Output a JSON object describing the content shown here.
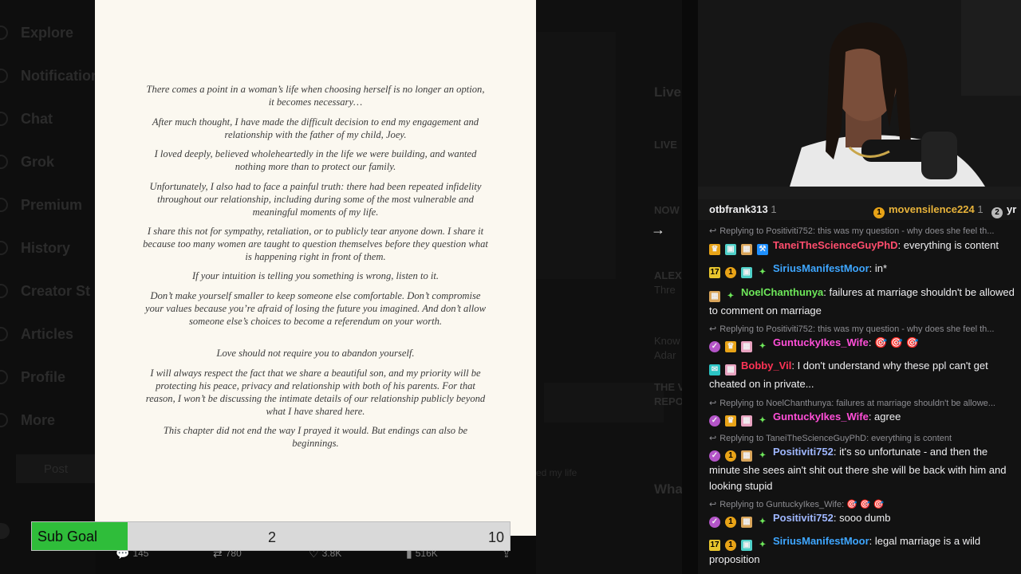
{
  "sidebar": {
    "items": [
      {
        "label": "Explore",
        "icon": "search-icon"
      },
      {
        "label": "Notifications",
        "icon": "bell-icon"
      },
      {
        "label": "Chat",
        "icon": "chat-icon"
      },
      {
        "label": "Grok",
        "icon": "grok-icon"
      },
      {
        "label": "Premium",
        "icon": "x-logo-icon"
      },
      {
        "label": "History",
        "icon": "history-icon"
      },
      {
        "label": "Creator St",
        "icon": "lightning-icon"
      },
      {
        "label": "Articles",
        "icon": "article-icon"
      },
      {
        "label": "Profile",
        "icon": "person-icon"
      },
      {
        "label": "More",
        "icon": "more-icon"
      }
    ],
    "post_button": "Post"
  },
  "document": {
    "paragraphs": [
      "There comes a point in a woman’s life when choosing herself is no longer an option, it becomes necessary…",
      "After much thought, I have made the difficult decision to end my engagement and relationship with the father of my child, Joey.",
      "I loved deeply, believed wholeheartedly in the life we were building, and wanted nothing more than to protect our family.",
      "Unfortunately, I also had to face a painful truth: there had been repeated infidelity throughout our relationship, including during some of the most vulnerable and meaningful moments of my life.",
      "I share this not for sympathy, retaliation, or to publicly tear anyone down. I share it because too many women are taught to question themselves before they question what is happening right in front of them.",
      "If your intuition is telling you something is wrong, listen to it.",
      "Don’t make yourself smaller to keep someone else comfortable. Don’t compromise your values because you’re afraid of losing the future you imagined. And don’t allow someone else’s choices to become a referendum on your worth.",
      "Love should not require you to abandon yourself.",
      "I will always respect the fact that we share a beautiful son, and my priority will be protecting his peace, privacy and relationship with both of his parents. For that reason, I won’t be discussing the intimate details of our relationship publicly beyond what I have shared here.",
      "This chapter did not end the way I prayed it would. But endings can also be beginnings."
    ]
  },
  "stats": {
    "replies": "145",
    "reposts": "780",
    "likes": "3.8K",
    "views": "516K"
  },
  "sub_goal": {
    "label": "Sub Goal",
    "current": "2",
    "target": "10",
    "fill_fraction": 0.2,
    "fill_color": "#2fbd3a"
  },
  "background_feed": {
    "right_fragments": [
      "Live",
      "LIVE",
      "NOW",
      "ALEX",
      "Thre",
      "Know",
      "Adar",
      "THE V",
      "REPO",
      "Wha"
    ],
    "caption_fragment": "ed my life"
  },
  "chat": {
    "pinned": [
      {
        "name": "otbfrank313",
        "count": "1"
      },
      {
        "name": "movensilence224",
        "count": "1",
        "badge": "1"
      },
      {
        "name": "yr",
        "badge": "2"
      }
    ],
    "messages": [
      {
        "reply": "Replying to Positiviti752: this was my question - why does she feel th...",
        "user": "TaneiTheScienceGuyPhD",
        "color": "#ff4d6d",
        "text": "everything is content",
        "badges": [
          "crown-icon",
          "cheer-icon",
          "gift-icon",
          "hammer-icon"
        ]
      },
      {
        "user": "SiriusManifestMoor",
        "color": "#3ea6ff",
        "text": "in*",
        "badges": [
          "17",
          "1",
          "cheer-icon",
          "plus-icon"
        ]
      },
      {
        "user": "NoelChanthunya",
        "color": "#6ee85a",
        "text": "failures at marriage shouldn't be allowed to comment on marriage",
        "badges": [
          "gift-icon",
          "plus-icon"
        ]
      },
      {
        "reply": "Replying to Positiviti752: this was my question - why does she feel th...",
        "user": "GuntuckyIkes_Wife",
        "color": "#ff4fd8",
        "text": "🎯 🎯 🎯",
        "badges": [
          "verified-icon",
          "crown-icon",
          "gift-icon",
          "plus-icon"
        ]
      },
      {
        "user": "Bobby_Vil",
        "color": "#ff3355",
        "text": "I don't understand why these ppl can't get cheated on in private...",
        "badges": [
          "prime-icon",
          "gift-icon"
        ]
      },
      {
        "reply": "Replying to NoelChanthunya: failures at marriage shouldn't be allowe...",
        "user": "GuntuckyIkes_Wife",
        "color": "#ff4fd8",
        "text": "agree",
        "badges": [
          "verified-icon",
          "crown-icon",
          "gift-icon",
          "plus-icon"
        ]
      },
      {
        "reply": "Replying to TaneiTheScienceGuyPhD: everything is content",
        "user": "Positiviti752",
        "color": "#9fb7ff",
        "text": "it's so unfortunate - and then the minute she sees ain't shit out there she will be back with him and looking stupid",
        "badges": [
          "verified-icon",
          "1",
          "gift-icon",
          "plus-icon"
        ]
      },
      {
        "reply": "Replying to GuntuckyIkes_Wife: 🎯 🎯 🎯",
        "user": "Positiviti752",
        "color": "#9fb7ff",
        "text": "sooo dumb",
        "badges": [
          "verified-icon",
          "1",
          "gift-icon",
          "plus-icon"
        ]
      },
      {
        "user": "SiriusManifestMoor",
        "color": "#3ea6ff",
        "text": "legal marriage is a wild proposition",
        "badges": [
          "17",
          "1",
          "cheer-icon",
          "plus-icon"
        ]
      }
    ]
  }
}
